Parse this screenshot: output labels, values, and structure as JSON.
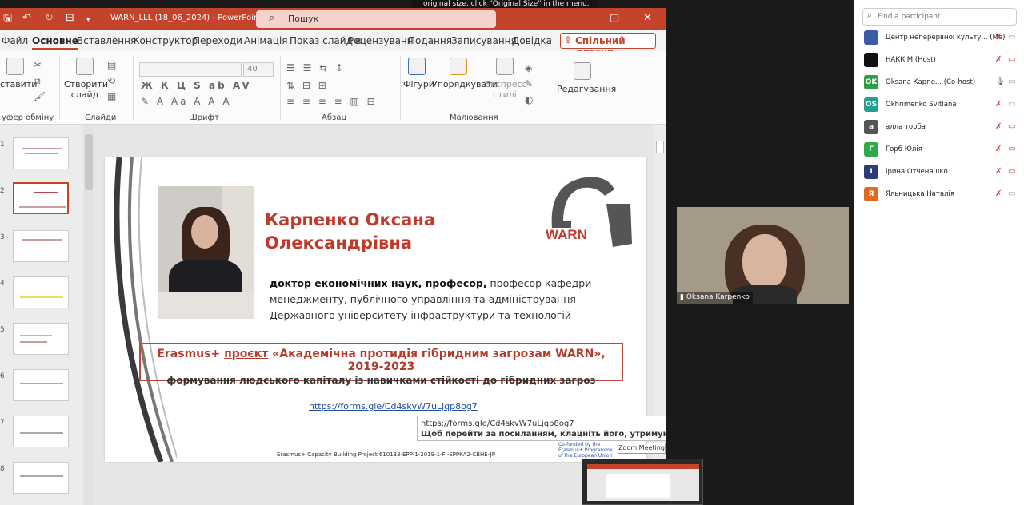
{
  "ppt": {
    "filename": "WARN_LLL (18_06_2024)",
    "app": "PowerPoint",
    "search_placeholder": "Пошук",
    "tabs": [
      "Файл",
      "Основне",
      "Вставлення",
      "Конструктор",
      "Переходи",
      "Анімація",
      "Показ слайдів",
      "Рецензуванн",
      "Подання",
      "Записування",
      "Довідка"
    ],
    "share_label": "Спільний доступ",
    "ribbon": {
      "paste": "ставити",
      "new_slide_1": "Створити",
      "new_slide_2": "слайд",
      "font_size": "40",
      "shapes": "Фігури",
      "arrange": "Упорядкувати",
      "quick_styles_1": "Експресс-",
      "quick_styles_2": "стилі",
      "editing": "Редагування",
      "groups": {
        "clipboard": "уфер обміну",
        "slides": "Слайди",
        "font": "Шрифт",
        "paragraph": "Абзац",
        "drawing": "Малювання"
      }
    },
    "slide_numbers": [
      "1",
      "2",
      "3",
      "4",
      "5",
      "6",
      "7",
      "8"
    ]
  },
  "slide": {
    "name_line1": "Карпенко Оксана",
    "name_line2": "Олександрівна",
    "desc_bold": "доктор економічних наук,  професор,",
    "desc_line1_rest": " професор  кафедри",
    "desc_line2": "менеджменту, публічного управління та адміністрування",
    "desc_line3": "Державного університету інфраструктури та технологій",
    "erasmus_pre": "Erasmus+ ",
    "erasmus_project": "проєкт",
    "erasmus_post": " «Академічна протидія гібридним загрозам WARN», 2019-2023",
    "erasmus_sub": "формування людського капіталу із навичками стійкості до гібридних загроз",
    "link": "https://forms.gle/Cd4skvW7uLjqp8og7",
    "footer": "Erasmus+ Capacity Building Project  610133-EPP-1-2019-1-FI-EPPKA2-CBHE-JP",
    "cofund_1": "Co-funded by the",
    "cofund_2": "Erasmus+ Programme",
    "cofund_3": "of the European Union",
    "logo_text": "WARN"
  },
  "tooltip": {
    "url": "https://forms.gle/Cd4skvW7uLjqp8og7",
    "hint": "Щоб перейти за посиланням, клацніть його, утримуючи натис"
  },
  "zoom": {
    "banner": "original size, click \"Original Size\" in the menu.",
    "meeting_label": "Zoom Meeting",
    "video_name": "Oksana Karpenko",
    "find_placeholder": "Find a participant",
    "participants": [
      {
        "initials": "",
        "name": "Центр неперервної культу... (Me)",
        "color": "#3b5ba8"
      },
      {
        "initials": "",
        "name": "НАККІМ (Host)",
        "color": "#111111"
      },
      {
        "initials": "OK",
        "name": "Oksana Карпе... (Co-host)",
        "color": "#2e9e45"
      },
      {
        "initials": "OS",
        "name": "Okhrimenko Svitlana",
        "color": "#23a092"
      },
      {
        "initials": "а",
        "name": "алла торба",
        "color": "#555555"
      },
      {
        "initials": "Г",
        "name": "Горб Юлія",
        "color": "#2eaa48"
      },
      {
        "initials": "І",
        "name": "Ірина Отченашко",
        "color": "#2c3e7a"
      },
      {
        "initials": "Я",
        "name": "Яльницька Наталія",
        "color": "#e06a1e"
      }
    ]
  }
}
